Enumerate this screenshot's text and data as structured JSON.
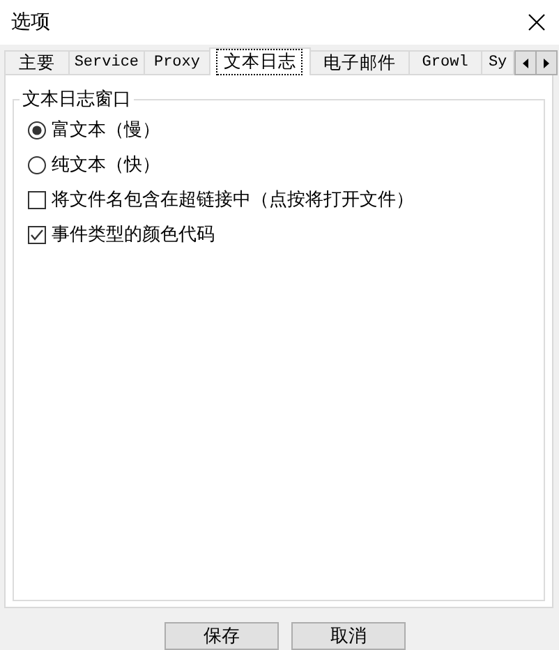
{
  "window": {
    "title": "选项"
  },
  "tabs": [
    {
      "label": "主要",
      "selected": false,
      "kind": "cjk"
    },
    {
      "label": "Service",
      "selected": false,
      "kind": "latin"
    },
    {
      "label": "Proxy",
      "selected": false,
      "kind": "latin"
    },
    {
      "label": "文本日志",
      "selected": true,
      "kind": "cjk"
    },
    {
      "label": "电子邮件",
      "selected": false,
      "kind": "cjk"
    },
    {
      "label": "Growl",
      "selected": false,
      "kind": "latin"
    },
    {
      "label": "Sy",
      "selected": false,
      "kind": "latin"
    }
  ],
  "group": {
    "title": "文本日志窗口",
    "options": [
      {
        "kind": "radio",
        "label": "富文本（慢）",
        "checked": true
      },
      {
        "kind": "radio",
        "label": "纯文本（快）",
        "checked": false
      },
      {
        "kind": "checkbox",
        "label": "将文件名包含在超链接中（点按将打开文件）",
        "checked": false
      },
      {
        "kind": "checkbox",
        "label": "事件类型的颜色代码",
        "checked": true
      }
    ]
  },
  "buttons": [
    {
      "label": "保存"
    },
    {
      "label": "取消"
    }
  ]
}
